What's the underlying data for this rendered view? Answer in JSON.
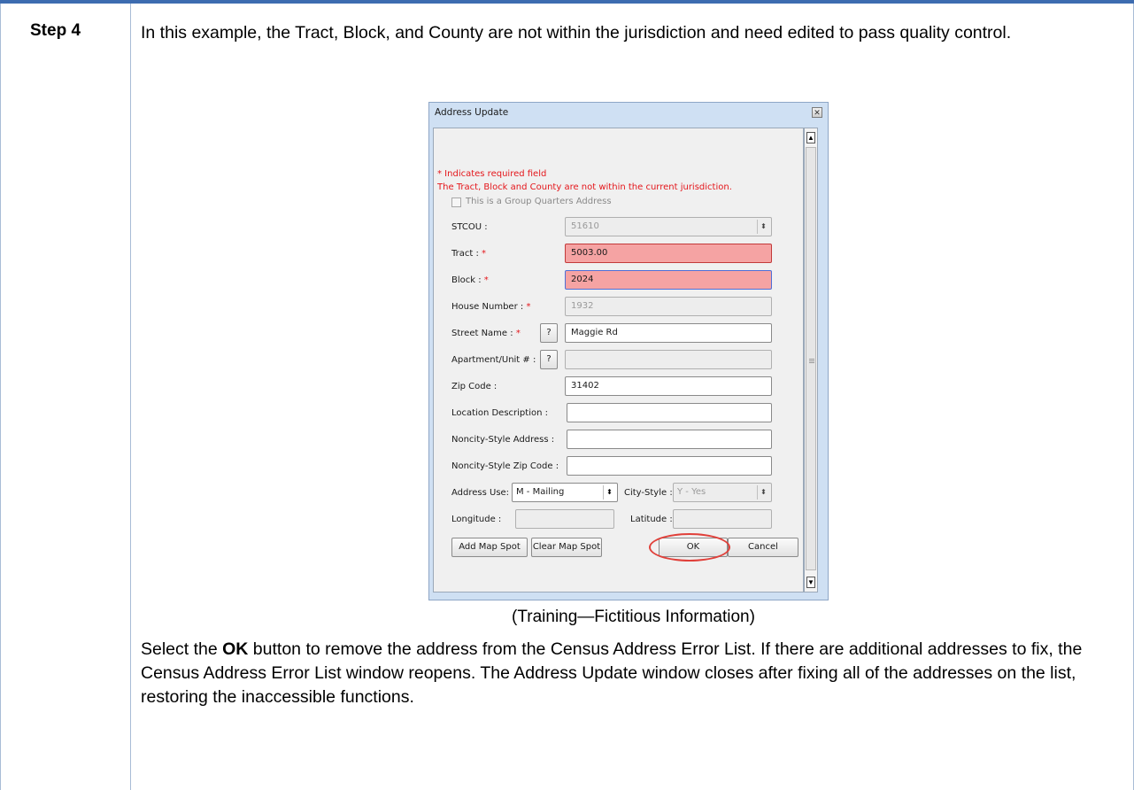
{
  "step": {
    "label": "Step 4"
  },
  "intro": "In this example, the Tract, Block, and County are not within the jurisdiction and need edited to pass quality control.",
  "dialog": {
    "title": "Address Update",
    "close_glyph": "✕",
    "required_note": "* Indicates required field",
    "error_message": "The Tract, Block and County are not within the current jurisdiction.",
    "group_quarters_label": "This is a Group Quarters Address",
    "fields": {
      "stcou": {
        "label": "STCOU :",
        "value": "51610"
      },
      "tract": {
        "label": "Tract :",
        "required": "*",
        "value": "5003.00"
      },
      "block": {
        "label": "Block :",
        "required": "*",
        "value": "2024"
      },
      "house_number": {
        "label": "House Number :",
        "required": "*",
        "value": "1932"
      },
      "street_name": {
        "label": "Street Name :",
        "required": "*",
        "help": "?",
        "value": "Maggie Rd"
      },
      "apartment": {
        "label": "Apartment/Unit # :",
        "help": "?",
        "value": ""
      },
      "zip_code": {
        "label": "Zip Code :",
        "value": "31402"
      },
      "location_description": {
        "label": "Location Description :",
        "value": ""
      },
      "noncity_address": {
        "label": "Noncity-Style Address :",
        "value": ""
      },
      "noncity_zip": {
        "label": "Noncity-Style Zip Code :",
        "value": ""
      },
      "address_use": {
        "label": "Address Use:",
        "value": "M - Mailing"
      },
      "city_style": {
        "label": "City-Style :",
        "value": "Y - Yes"
      },
      "longitude": {
        "label": "Longitude :",
        "value": ""
      },
      "latitude": {
        "label": "Latitude :",
        "value": ""
      }
    },
    "buttons": {
      "add_map_spot": "Add Map Spot",
      "clear_map_spot": "Clear Map Spot",
      "ok": "OK",
      "cancel": "Cancel"
    },
    "spin_glyph": "⬍",
    "scroll_up": "▲",
    "scroll_down": "▼"
  },
  "caption": "(Training—Fictitious Information)",
  "outro": {
    "before_bold": "Select the ",
    "bold": "OK",
    "after_bold": " button to remove the address from the Census Address Error List. If there are additional addresses to fix, the Census Address Error List window reopens. The Address Update window closes after fixing all of the addresses on the list, restoring the inaccessible functions."
  },
  "colors": {
    "accent": "#3d6cb0",
    "error_fill": "#f5a3a3",
    "error_text": "#e4161b",
    "highlight_circle": "#e0403a"
  }
}
